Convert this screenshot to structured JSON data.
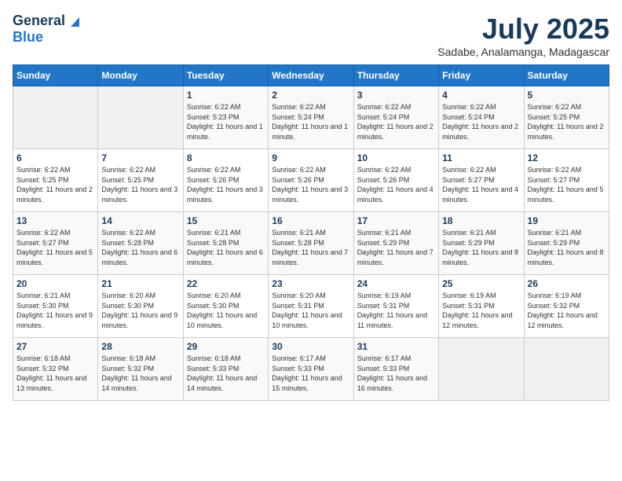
{
  "logo": {
    "general": "General",
    "blue": "Blue"
  },
  "header": {
    "month": "July 2025",
    "location": "Sadabe, Analamanga, Madagascar"
  },
  "days_of_week": [
    "Sunday",
    "Monday",
    "Tuesday",
    "Wednesday",
    "Thursday",
    "Friday",
    "Saturday"
  ],
  "weeks": [
    [
      {
        "day": "",
        "sunrise": "",
        "sunset": "",
        "daylight": ""
      },
      {
        "day": "",
        "sunrise": "",
        "sunset": "",
        "daylight": ""
      },
      {
        "day": "1",
        "sunrise": "Sunrise: 6:22 AM",
        "sunset": "Sunset: 5:23 PM",
        "daylight": "Daylight: 11 hours and 1 minute."
      },
      {
        "day": "2",
        "sunrise": "Sunrise: 6:22 AM",
        "sunset": "Sunset: 5:24 PM",
        "daylight": "Daylight: 11 hours and 1 minute."
      },
      {
        "day": "3",
        "sunrise": "Sunrise: 6:22 AM",
        "sunset": "Sunset: 5:24 PM",
        "daylight": "Daylight: 11 hours and 2 minutes."
      },
      {
        "day": "4",
        "sunrise": "Sunrise: 6:22 AM",
        "sunset": "Sunset: 5:24 PM",
        "daylight": "Daylight: 11 hours and 2 minutes."
      },
      {
        "day": "5",
        "sunrise": "Sunrise: 6:22 AM",
        "sunset": "Sunset: 5:25 PM",
        "daylight": "Daylight: 11 hours and 2 minutes."
      }
    ],
    [
      {
        "day": "6",
        "sunrise": "Sunrise: 6:22 AM",
        "sunset": "Sunset: 5:25 PM",
        "daylight": "Daylight: 11 hours and 2 minutes."
      },
      {
        "day": "7",
        "sunrise": "Sunrise: 6:22 AM",
        "sunset": "Sunset: 5:25 PM",
        "daylight": "Daylight: 11 hours and 3 minutes."
      },
      {
        "day": "8",
        "sunrise": "Sunrise: 6:22 AM",
        "sunset": "Sunset: 5:26 PM",
        "daylight": "Daylight: 11 hours and 3 minutes."
      },
      {
        "day": "9",
        "sunrise": "Sunrise: 6:22 AM",
        "sunset": "Sunset: 5:26 PM",
        "daylight": "Daylight: 11 hours and 3 minutes."
      },
      {
        "day": "10",
        "sunrise": "Sunrise: 6:22 AM",
        "sunset": "Sunset: 5:26 PM",
        "daylight": "Daylight: 11 hours and 4 minutes."
      },
      {
        "day": "11",
        "sunrise": "Sunrise: 6:22 AM",
        "sunset": "Sunset: 5:27 PM",
        "daylight": "Daylight: 11 hours and 4 minutes."
      },
      {
        "day": "12",
        "sunrise": "Sunrise: 6:22 AM",
        "sunset": "Sunset: 5:27 PM",
        "daylight": "Daylight: 11 hours and 5 minutes."
      }
    ],
    [
      {
        "day": "13",
        "sunrise": "Sunrise: 6:22 AM",
        "sunset": "Sunset: 5:27 PM",
        "daylight": "Daylight: 11 hours and 5 minutes."
      },
      {
        "day": "14",
        "sunrise": "Sunrise: 6:22 AM",
        "sunset": "Sunset: 5:28 PM",
        "daylight": "Daylight: 11 hours and 6 minutes."
      },
      {
        "day": "15",
        "sunrise": "Sunrise: 6:21 AM",
        "sunset": "Sunset: 5:28 PM",
        "daylight": "Daylight: 11 hours and 6 minutes."
      },
      {
        "day": "16",
        "sunrise": "Sunrise: 6:21 AM",
        "sunset": "Sunset: 5:28 PM",
        "daylight": "Daylight: 11 hours and 7 minutes."
      },
      {
        "day": "17",
        "sunrise": "Sunrise: 6:21 AM",
        "sunset": "Sunset: 5:29 PM",
        "daylight": "Daylight: 11 hours and 7 minutes."
      },
      {
        "day": "18",
        "sunrise": "Sunrise: 6:21 AM",
        "sunset": "Sunset: 5:29 PM",
        "daylight": "Daylight: 11 hours and 8 minutes."
      },
      {
        "day": "19",
        "sunrise": "Sunrise: 6:21 AM",
        "sunset": "Sunset: 5:29 PM",
        "daylight": "Daylight: 11 hours and 8 minutes."
      }
    ],
    [
      {
        "day": "20",
        "sunrise": "Sunrise: 6:21 AM",
        "sunset": "Sunset: 5:30 PM",
        "daylight": "Daylight: 11 hours and 9 minutes."
      },
      {
        "day": "21",
        "sunrise": "Sunrise: 6:20 AM",
        "sunset": "Sunset: 5:30 PM",
        "daylight": "Daylight: 11 hours and 9 minutes."
      },
      {
        "day": "22",
        "sunrise": "Sunrise: 6:20 AM",
        "sunset": "Sunset: 5:30 PM",
        "daylight": "Daylight: 11 hours and 10 minutes."
      },
      {
        "day": "23",
        "sunrise": "Sunrise: 6:20 AM",
        "sunset": "Sunset: 5:31 PM",
        "daylight": "Daylight: 11 hours and 10 minutes."
      },
      {
        "day": "24",
        "sunrise": "Sunrise: 6:19 AM",
        "sunset": "Sunset: 5:31 PM",
        "daylight": "Daylight: 11 hours and 11 minutes."
      },
      {
        "day": "25",
        "sunrise": "Sunrise: 6:19 AM",
        "sunset": "Sunset: 5:31 PM",
        "daylight": "Daylight: 11 hours and 12 minutes."
      },
      {
        "day": "26",
        "sunrise": "Sunrise: 6:19 AM",
        "sunset": "Sunset: 5:32 PM",
        "daylight": "Daylight: 11 hours and 12 minutes."
      }
    ],
    [
      {
        "day": "27",
        "sunrise": "Sunrise: 6:18 AM",
        "sunset": "Sunset: 5:32 PM",
        "daylight": "Daylight: 11 hours and 13 minutes."
      },
      {
        "day": "28",
        "sunrise": "Sunrise: 6:18 AM",
        "sunset": "Sunset: 5:32 PM",
        "daylight": "Daylight: 11 hours and 14 minutes."
      },
      {
        "day": "29",
        "sunrise": "Sunrise: 6:18 AM",
        "sunset": "Sunset: 5:33 PM",
        "daylight": "Daylight: 11 hours and 14 minutes."
      },
      {
        "day": "30",
        "sunrise": "Sunrise: 6:17 AM",
        "sunset": "Sunset: 5:33 PM",
        "daylight": "Daylight: 11 hours and 15 minutes."
      },
      {
        "day": "31",
        "sunrise": "Sunrise: 6:17 AM",
        "sunset": "Sunset: 5:33 PM",
        "daylight": "Daylight: 11 hours and 16 minutes."
      },
      {
        "day": "",
        "sunrise": "",
        "sunset": "",
        "daylight": ""
      },
      {
        "day": "",
        "sunrise": "",
        "sunset": "",
        "daylight": ""
      }
    ]
  ]
}
